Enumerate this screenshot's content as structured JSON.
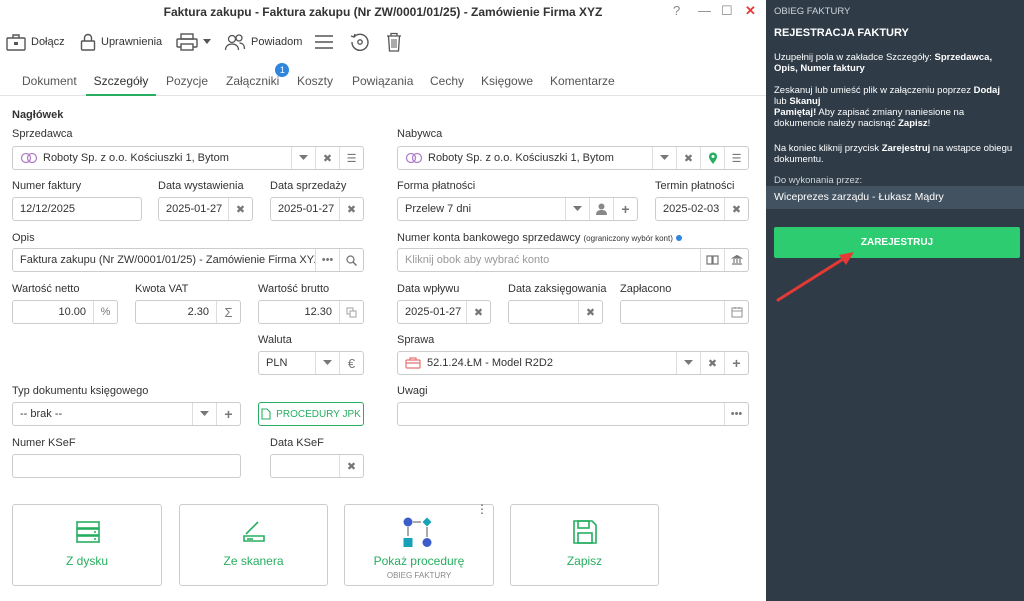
{
  "window": {
    "title": "Faktura zakupu - Faktura zakupu (Nr ZW/0001/01/25) - Zamówienie Firma XYZ",
    "help": "?",
    "minimize": "—",
    "maximize": "☐",
    "close": "✕"
  },
  "toolbar": {
    "attach": "Dołącz",
    "permissions": "Uprawnienia",
    "notify": "Powiadom"
  },
  "tabs": [
    {
      "label": "Dokument"
    },
    {
      "label": "Szczegóły"
    },
    {
      "label": "Pozycje"
    },
    {
      "label": "Załączniki",
      "badge": "1"
    },
    {
      "label": "Koszty"
    },
    {
      "label": "Powiązania"
    },
    {
      "label": "Cechy"
    },
    {
      "label": "Księgowe"
    },
    {
      "label": "Komentarze"
    }
  ],
  "form": {
    "header": "Nagłówek",
    "seller_label": "Sprzedawca",
    "seller_value": "Roboty Sp. z o.o. Kościuszki 1, Bytom",
    "buyer_label": "Nabywca",
    "buyer_value": "Roboty Sp. z o.o. Kościuszki 1, Bytom",
    "invoice_no_label": "Numer faktury",
    "invoice_no": "12/12/2025",
    "issue_date_label": "Data wystawienia",
    "issue_date": "2025-01-27",
    "sale_date_label": "Data sprzedaży",
    "sale_date": "2025-01-27",
    "payment_form_label": "Forma płatności",
    "payment_form": "Przelew 7 dni",
    "payment_due_label": "Termin płatności",
    "payment_due": "2025-02-03",
    "desc_label": "Opis",
    "desc": "Faktura zakupu (Nr ZW/0001/01/25) - Zamówienie Firma XYZ",
    "account_label": "Numer konta bankowego sprzedawcy",
    "account_note": "(ograniczony wybór kont)",
    "account_placeholder": "Kliknij obok aby wybrać konto",
    "net_label": "Wartość netto",
    "net": "10.00",
    "net_btn": "%",
    "vat_label": "Kwota VAT",
    "vat": "2.30",
    "vat_btn": "Σ",
    "gross_label": "Wartość brutto",
    "gross": "12.30",
    "inflow_label": "Data wpływu",
    "inflow": "2025-01-27",
    "booking_label": "Data zaksięgowania",
    "paid_label": "Zapłacono",
    "currency_label": "Waluta",
    "currency": "PLN",
    "currency_btn": "€",
    "case_label": "Sprawa",
    "case": "52.1.24.ŁM - Model R2D2",
    "doc_type_label": "Typ dokumentu księgowego",
    "doc_type": "-- brak --",
    "jpk_btn": "PROCEDURY JPK",
    "notes_label": "Uwagi",
    "ksef_no_label": "Numer KSeF",
    "ksef_date_label": "Data KSeF"
  },
  "tiles": {
    "disk": "Z dysku",
    "scanner": "Ze skanera",
    "procedure": "Pokaż procedurę",
    "procedure_sub": "OBIEG FAKTURY",
    "save": "Zapisz"
  },
  "sidebar": {
    "section": "OBIEG FAKTURY",
    "title": "REJESTRACJA FAKTURY",
    "p1_a": "Uzupełnij pola w zakładce Szczegóły: ",
    "p1_b": "Sprzedawca, Opis, Numer faktury",
    "p2_a": "Zeskanuj lub umieść plik w załączeniu poprzez ",
    "p2_b": "Dodaj",
    "p2_c": " lub ",
    "p2_d": "Skanuj",
    "p2_e": "Pamiętaj!",
    "p2_f": " Aby zapisać zmiany naniesione na dokumencie należy nacisnąć ",
    "p2_g": "Zapisz",
    "p2_h": "!",
    "p3_a": "Na koniec kliknij przycisk ",
    "p3_b": "Zarejestruj",
    "p3_c": " na wstąpce obiegu dokumentu.",
    "assignee_label": "Do wykonania przez:",
    "assignee": "Wiceprezes zarządu - Łukasz Mądry",
    "register_btn": "ZAREJESTRUJ"
  },
  "colors": {
    "accent": "#27ae60",
    "button": "#2ecc71",
    "sidebar": "#2f3c48",
    "arrow": "#e53935",
    "badge": "#2e86de"
  }
}
